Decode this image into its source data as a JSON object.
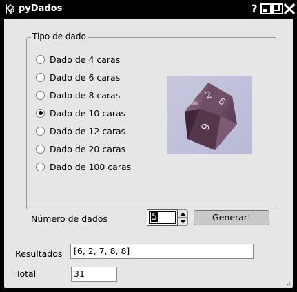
{
  "window": {
    "title": "pyDados",
    "help_glyph": "?"
  },
  "group": {
    "title": "Tipo de dado",
    "options": [
      {
        "label": "Dado de 4 caras",
        "checked": false
      },
      {
        "label": "Dado de 6 caras",
        "checked": false
      },
      {
        "label": "Dado de 8 caras",
        "checked": false
      },
      {
        "label": "Dado de 10 caras",
        "checked": true
      },
      {
        "label": "Dado de 12 caras",
        "checked": false
      },
      {
        "label": "Dado de 20 caras",
        "checked": false
      },
      {
        "label": "Dado de 100 caras",
        "checked": false
      }
    ]
  },
  "number": {
    "label": "Número de dados",
    "value": "5"
  },
  "generate_button": "Generar!",
  "results": {
    "label": "Resultados",
    "value": "[6, 2, 7, 8, 8]"
  },
  "total": {
    "label": "Total",
    "value": "31"
  },
  "colors": {
    "titlebar": "#000000",
    "client_bg": "#e6e6e6",
    "button_bg": "#c8c8c8"
  }
}
